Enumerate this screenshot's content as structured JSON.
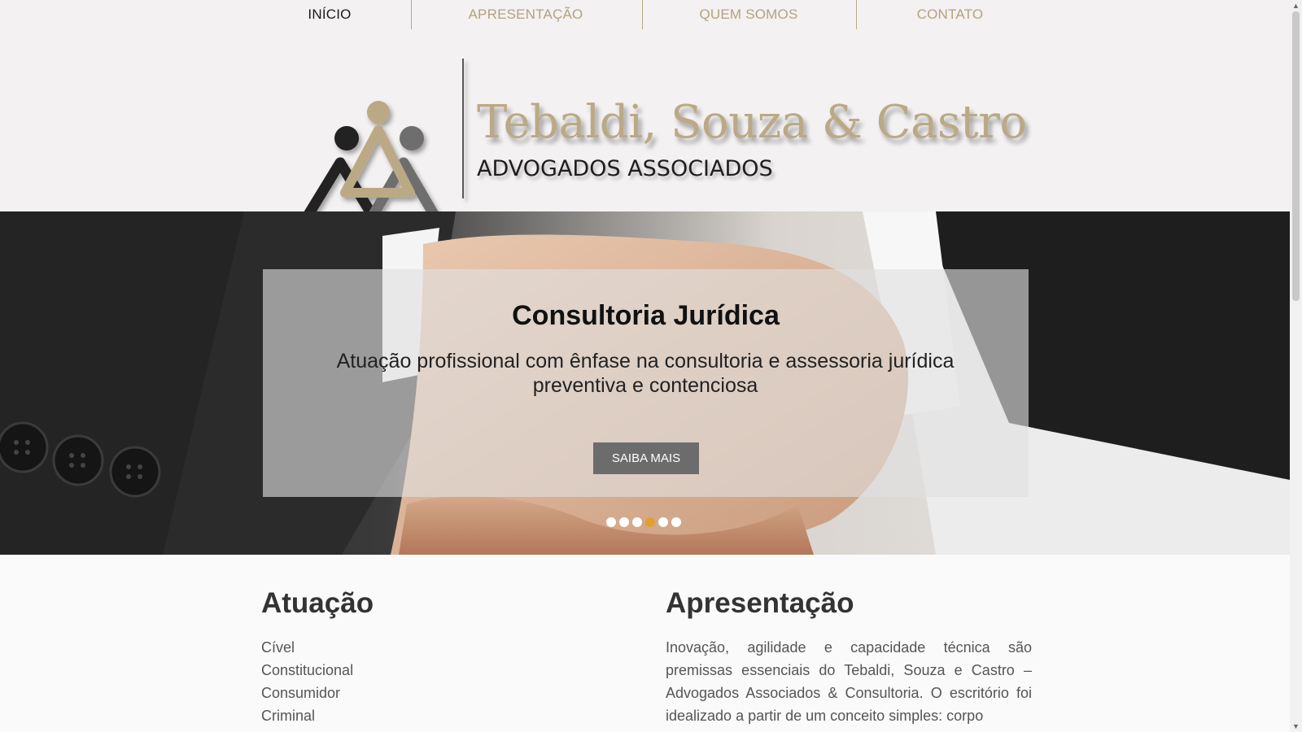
{
  "nav": {
    "items": [
      {
        "label": "INÍCIO",
        "active": true
      },
      {
        "label": "APRESENTAÇÃO",
        "active": false
      },
      {
        "label": "QUEM SOMOS",
        "active": false
      },
      {
        "label": "CONTATO",
        "active": false
      }
    ]
  },
  "header": {
    "firm_name": "Tebaldi, Souza & Castro",
    "firm_subtitle": "ADVOGADOS ASSOCIADOS"
  },
  "hero": {
    "title": "Consultoria Jurídica",
    "text": "Atuação profissional com ênfase na consultoria e assessoria jurídica preventiva e contenciosa",
    "button_label": "SAIBA MAIS",
    "slide_count": 6,
    "active_slide": 4
  },
  "atuacao": {
    "title": "Atuação",
    "items": [
      "Cível",
      "Constitucional",
      "Consumidor",
      "Criminal"
    ]
  },
  "apresentacao": {
    "title": "Apresentação",
    "text": "Inovação, agilidade e capacidade técnica são premissas essenciais do Tebaldi, Souza e Castro – Advogados Associados & Consultoria.  O escritório foi idealizado a partir de um conceito simples: corpo"
  },
  "colors": {
    "accent": "#b4a27e",
    "active_dot": "#e2a033",
    "button": "#6c6c6c"
  }
}
